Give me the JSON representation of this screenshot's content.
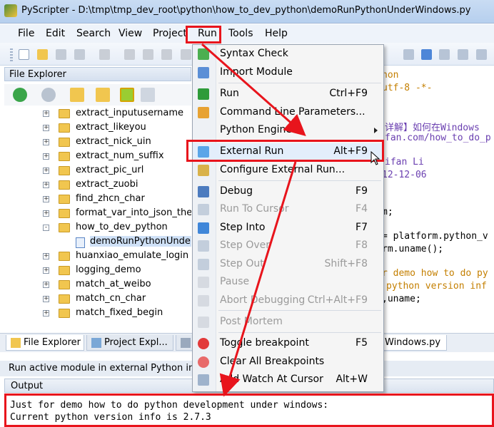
{
  "window": {
    "title": "PyScripter - D:\\tmp\\tmp_dev_root\\python\\how_to_dev_python\\demoRunPythonUnderWindows.py"
  },
  "menubar": {
    "items": [
      "File",
      "Edit",
      "Search",
      "View",
      "Project",
      "Run",
      "Tools",
      "Help"
    ]
  },
  "file_explorer": {
    "title": "File Explorer",
    "tree": [
      {
        "label": "extract_inputusername",
        "type": "folder",
        "expander": "+"
      },
      {
        "label": "extract_likeyou",
        "type": "folder",
        "expander": "+"
      },
      {
        "label": "extract_nick_uin",
        "type": "folder",
        "expander": "+"
      },
      {
        "label": "extract_num_suffix",
        "type": "folder",
        "expander": "+"
      },
      {
        "label": "extract_pic_url",
        "type": "folder",
        "expander": "+"
      },
      {
        "label": "extract_zuobi",
        "type": "folder",
        "expander": "+"
      },
      {
        "label": "find_zhcn_char",
        "type": "folder",
        "expander": "+"
      },
      {
        "label": "format_var_into_json_then",
        "type": "folder",
        "expander": "+"
      },
      {
        "label": "how_to_dev_python",
        "type": "folder",
        "expander": "-"
      },
      {
        "label": "demoRunPythonUnder",
        "type": "file",
        "expander": ""
      },
      {
        "label": "huanxiao_emulate_login",
        "type": "folder",
        "expander": "+"
      },
      {
        "label": "logging_demo",
        "type": "folder",
        "expander": "+"
      },
      {
        "label": "match_at_weibo",
        "type": "folder",
        "expander": "+"
      },
      {
        "label": "match_cn_char",
        "type": "folder",
        "expander": "+"
      },
      {
        "label": "match_fixed_begin",
        "type": "folder",
        "expander": "+"
      }
    ]
  },
  "tabs": [
    {
      "label": "File Explorer"
    },
    {
      "label": "Project Expl..."
    },
    {
      "label": "Windows.py"
    }
  ],
  "status": {
    "text": "Run active module in external Python inte"
  },
  "output": {
    "title": "Output",
    "lines": [
      "Just for demo how to do python development under windows:",
      "Current python version info is 2.7.3"
    ]
  },
  "editor": {
    "lines": [
      {
        "text": "hon",
        "style": "comment"
      },
      {
        "text": "utf-8 -*-",
        "style": "comment"
      },
      {
        "text": "详解】如何在Windows",
        "style": "cjk"
      },
      {
        "text": "fan.com/how_to_do_p",
        "style": "cjk"
      },
      {
        "text": "ifan Li",
        "style": "cjk"
      },
      {
        "text": "12-12-06",
        "style": "cjk"
      },
      {
        "text": "m;",
        "style": "plain"
      },
      {
        "text": "= platform.python_v",
        "style": "plain"
      },
      {
        "text": "rm.uname();",
        "style": "plain"
      },
      {
        "text": "r demo how to do py",
        "style": "comment"
      },
      {
        "text": "python version inf",
        "style": "comment"
      },
      {
        "text": ",uname;",
        "style": "plain"
      }
    ]
  },
  "run_menu": {
    "items": [
      {
        "label": "Syntax Check",
        "shortcut": "",
        "icon": "check-icon",
        "disabled": false
      },
      {
        "label": "Import Module",
        "shortcut": "",
        "icon": "import-icon",
        "disabled": false
      },
      {
        "sep": true
      },
      {
        "label": "Run",
        "shortcut": "Ctrl+F9",
        "icon": "play-icon",
        "disabled": false
      },
      {
        "label": "Command Line Parameters...",
        "shortcut": "",
        "icon": "params-icon",
        "disabled": false
      },
      {
        "label": "Python Engine",
        "shortcut": "",
        "icon": "",
        "disabled": false,
        "submenu": true
      },
      {
        "sep": true
      },
      {
        "label": "External Run",
        "shortcut": "Alt+F9",
        "icon": "external-run-icon",
        "disabled": false,
        "highlight": true
      },
      {
        "label": "Configure External Run...",
        "shortcut": "",
        "icon": "configure-icon",
        "disabled": false
      },
      {
        "sep": true
      },
      {
        "label": "Debug",
        "shortcut": "F9",
        "icon": "debug-icon",
        "disabled": false
      },
      {
        "label": "Run To Cursor",
        "shortcut": "F4",
        "icon": "run-to-cursor-icon",
        "disabled": true
      },
      {
        "label": "Step Into",
        "shortcut": "F7",
        "icon": "step-into-icon",
        "disabled": false
      },
      {
        "label": "Step Over",
        "shortcut": "F8",
        "icon": "step-over-icon",
        "disabled": true
      },
      {
        "label": "Step Out",
        "shortcut": "Shift+F8",
        "icon": "step-out-icon",
        "disabled": true
      },
      {
        "label": "Pause",
        "shortcut": "",
        "icon": "pause-icon",
        "disabled": true
      },
      {
        "label": "Abort Debugging",
        "shortcut": "Ctrl+Alt+F9",
        "icon": "abort-icon",
        "disabled": true
      },
      {
        "sep": true
      },
      {
        "label": "Post Mortem",
        "shortcut": "",
        "icon": "post-mortem-icon",
        "disabled": true
      },
      {
        "sep": true
      },
      {
        "label": "Toggle breakpoint",
        "shortcut": "F5",
        "icon": "breakpoint-icon",
        "disabled": false
      },
      {
        "label": "Clear All Breakpoints",
        "shortcut": "",
        "icon": "clear-breakpoints-icon",
        "disabled": false
      },
      {
        "label": "Add Watch At Cursor",
        "shortcut": "Alt+W",
        "icon": "watch-icon",
        "disabled": false
      }
    ]
  },
  "colors": {
    "annotation": "#e8141c",
    "comment": "#c47f00",
    "cjk": "#6a3fb0",
    "selection": "#cfe1f7"
  }
}
